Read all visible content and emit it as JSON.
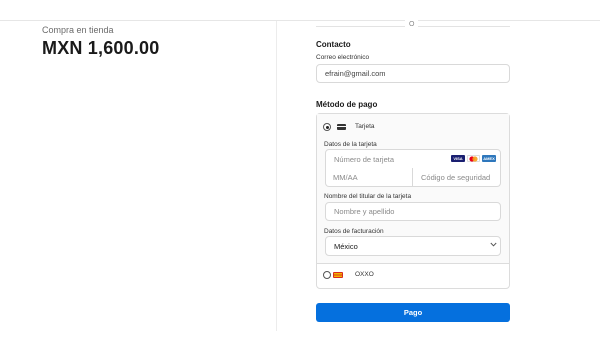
{
  "summary": {
    "store_label": "Compra en tienda",
    "total": "MXN 1,600.00"
  },
  "divider_text": "O",
  "contact": {
    "heading": "Contacto",
    "email_label": "Correo electrónico",
    "email_value": "efrain@gmail.com"
  },
  "payment": {
    "heading": "Método de pago",
    "card_option_label": "Tarjeta",
    "card_details_label": "Datos de la tarjeta",
    "card_number_placeholder": "Número de tarjeta",
    "expiry_placeholder": "MM/AA",
    "cvc_placeholder": "Código de seguridad",
    "brands": [
      {
        "name": "VISA",
        "color": "#1a1f71"
      },
      {
        "name": "MC",
        "color": "#eb001b"
      },
      {
        "name": "AMEX",
        "color": "#2e77bc"
      }
    ],
    "holder_label": "Nombre del titular de la tarjeta",
    "holder_placeholder": "Nombre y apellido",
    "billing_label": "Datos de facturación",
    "country_value": "México",
    "oxxo_logo_text": "OXXO",
    "oxxo_label": "OXXO",
    "selected_option": "Tarjeta"
  },
  "pay_button_label": "Pago",
  "colors": {
    "accent": "#0570de",
    "border": "#d9d9d9",
    "muted_text": "#8a8a8a"
  }
}
